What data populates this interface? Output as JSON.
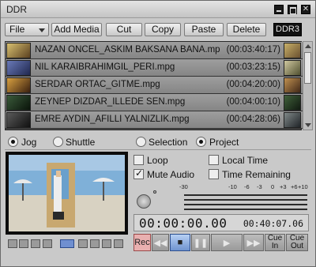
{
  "window": {
    "title": "DDR"
  },
  "toolbar": {
    "file_label": "File",
    "add_media_label": "Add Media",
    "cut_label": "Cut",
    "copy_label": "Copy",
    "paste_label": "Paste",
    "delete_label": "Delete",
    "device_badge": "DDR3"
  },
  "playlist": {
    "items": [
      {
        "name": "NAZAN ONCEL_ASKIM BAKSANA BANA.mp",
        "duration": "(00:03:40:17)"
      },
      {
        "name": "NIL KARAIBRAHIMGIL_PERI.mpg",
        "duration": "(00:03:23:15)"
      },
      {
        "name": "SERDAR ORTAC_GITME.mpg",
        "duration": "(00:04:20:00)"
      },
      {
        "name": "ZEYNEP DIZDAR_ILLEDE SEN.mpg",
        "duration": "(00:04:00:10)"
      },
      {
        "name": "EMRE AYDIN_AFILLI YALNIZLIK.mpg",
        "duration": "(00:04:28:06)"
      }
    ]
  },
  "mode": {
    "jog_label": "Jog",
    "shuttle_label": "Shuttle",
    "selection_label": "Selection",
    "project_label": "Project",
    "selected_left": "Jog",
    "selected_right": "Project"
  },
  "options": {
    "loop_label": "Loop",
    "local_time_label": "Local Time",
    "mute_audio_label": "Mute Audio",
    "time_remaining_label": "Time Remaining",
    "loop_checked": false,
    "local_time_checked": false,
    "mute_audio_checked": true,
    "time_remaining_checked": false
  },
  "meter": {
    "scale": [
      "-30",
      "-10",
      "-6",
      "-3",
      "0",
      "+3",
      "+6",
      "+10"
    ]
  },
  "timecode": {
    "current": "00:00:00.00",
    "total": "00:40:07.06"
  },
  "transport": {
    "rec_label": "Rec",
    "cue_in_label": "Cue In",
    "cue_out_label": "Cue Out"
  },
  "colors": {
    "rec_button": "#e9b0b0",
    "active_stop": "#6f93cf",
    "window_bg": "#c9c9c9"
  }
}
